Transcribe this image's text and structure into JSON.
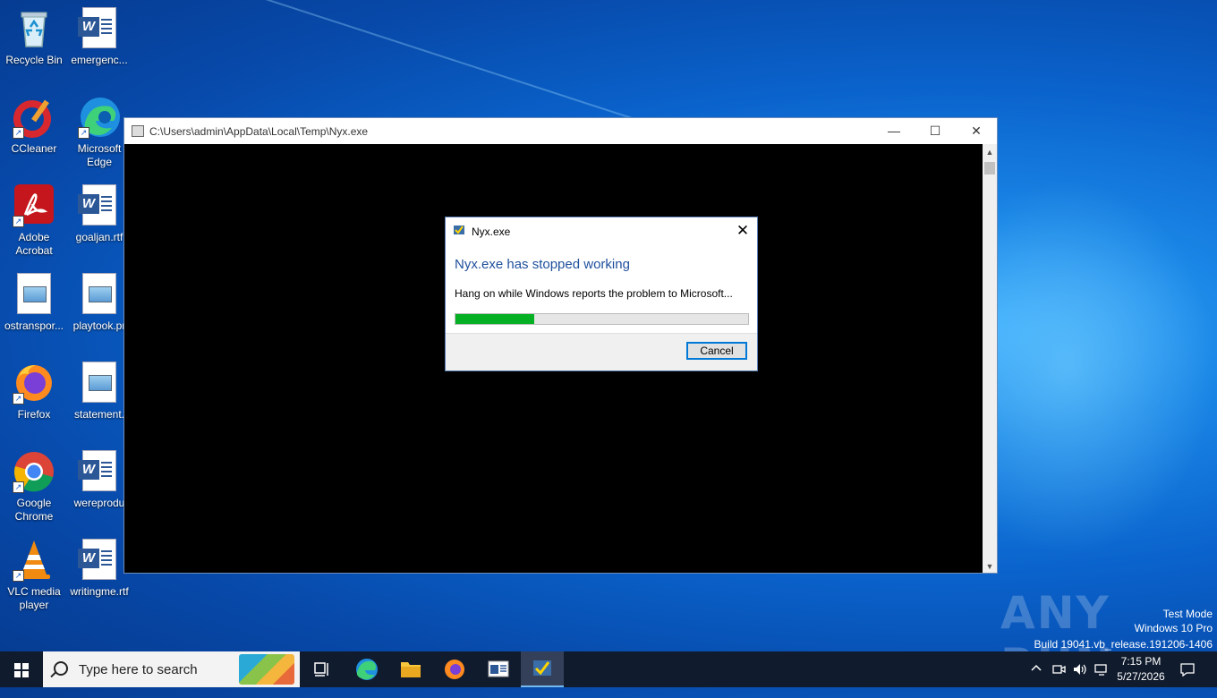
{
  "desktop": {
    "icons": [
      {
        "label": "Recycle Bin"
      },
      {
        "label": "emergenc..."
      },
      {
        "label": "CCleaner"
      },
      {
        "label": "Microsoft Edge"
      },
      {
        "label": "Adobe Acrobat"
      },
      {
        "label": "goaljan.rtf"
      },
      {
        "label": "ostranspor..."
      },
      {
        "label": "playtook.pr"
      },
      {
        "label": "Firefox"
      },
      {
        "label": "statement."
      },
      {
        "label": "Google Chrome"
      },
      {
        "label": "wereprodu"
      },
      {
        "label": "VLC media player"
      },
      {
        "label": "writingme.rtf"
      }
    ]
  },
  "console_window": {
    "title": "C:\\Users\\admin\\AppData\\Local\\Temp\\Nyx.exe",
    "minimize": "—",
    "maximize": "☐",
    "close": "✕"
  },
  "error_dialog": {
    "title": "Nyx.exe",
    "heading": "Nyx.exe has stopped working",
    "message": "Hang on while Windows reports the problem to Microsoft...",
    "progress_percent": 27,
    "cancel_label": "Cancel",
    "close": "✕"
  },
  "watermark": {
    "brand": "ANY RUN",
    "line1": "Test Mode",
    "line2": "Windows 10 Pro",
    "line3": "Build 19041.vb_release.191206-1406"
  },
  "taskbar": {
    "search_placeholder": "Type here to search",
    "time": "7:15 PM",
    "date": "5/27/2026"
  }
}
